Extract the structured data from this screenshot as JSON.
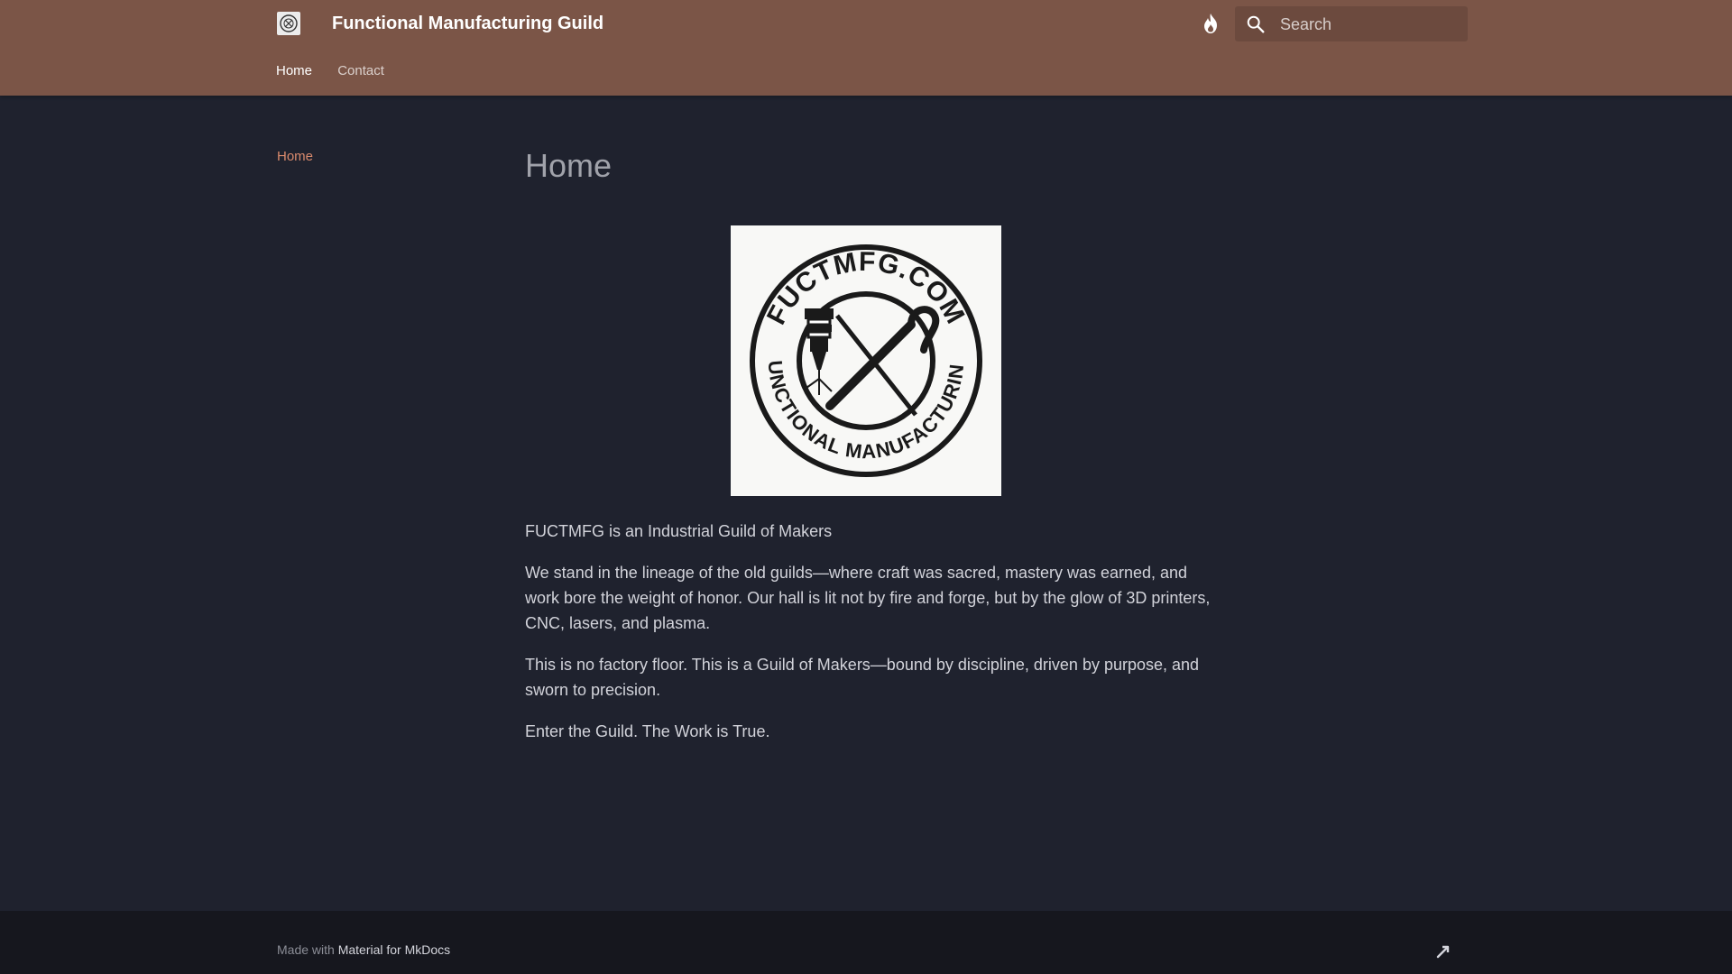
{
  "header": {
    "site_title": "Functional Manufacturing Guild",
    "search_placeholder": "Search",
    "icons": {
      "logo": "guild-seal-icon",
      "theme": "flame-icon",
      "search": "search-icon"
    },
    "colors": {
      "header_bg": "#7b5547",
      "accent": "#d98a6d",
      "page_bg": "#1f222e",
      "footer_bg": "#16171e"
    }
  },
  "tabs": [
    {
      "label": "Home",
      "active": true
    },
    {
      "label": "Contact",
      "active": false
    }
  ],
  "sidebar": {
    "items": [
      {
        "label": "Home",
        "active": true
      }
    ]
  },
  "main": {
    "title": "Home",
    "hero_image": {
      "logo_text_top": "FUCTMFG.COM",
      "logo_text_bottom": "FUNCTIONAL MANUFACTURING"
    },
    "paragraphs": [
      "FUCTMFG is an Industrial Guild of Makers",
      "We stand in the lineage of the old guilds—where craft was sacred, mastery was earned, and work bore the weight of honor. Our hall is lit not by fire and forge, but by the glow of 3D printers, CNC, lasers, and plasma.",
      "This is no factory floor. This is a Guild of Makers—bound by discipline, driven by purpose, and sworn to precision.",
      "Enter the Guild. The Work is True."
    ]
  },
  "footer": {
    "made_with": "Made with",
    "link_label": "Material for MkDocs",
    "icon": "mastodon-icon"
  }
}
